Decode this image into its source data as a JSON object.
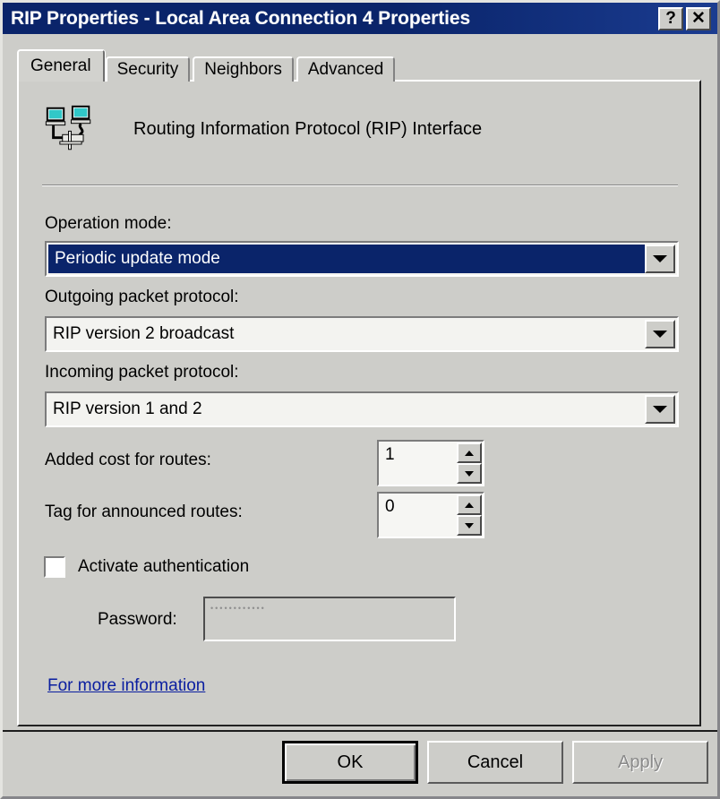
{
  "window": {
    "title": "RIP Properties - Local Area Connection 4 Properties",
    "help_button": "?",
    "close_button": "✕",
    "help_icon_name": "help-icon",
    "close_icon_name": "close-icon"
  },
  "tabs": [
    {
      "label": "General",
      "active": true
    },
    {
      "label": "Security",
      "active": false
    },
    {
      "label": "Neighbors",
      "active": false
    },
    {
      "label": "Advanced",
      "active": false
    }
  ],
  "header": {
    "caption": "Routing Information Protocol (RIP) Interface",
    "icon": "network-computers-icon"
  },
  "form": {
    "operation_mode": {
      "label": "Operation mode:",
      "value": "Periodic update mode",
      "selected": true
    },
    "outgoing_protocol": {
      "label": "Outgoing packet protocol:",
      "value": "RIP version 2 broadcast"
    },
    "incoming_protocol": {
      "label": "Incoming packet protocol:",
      "value": "RIP version 1 and 2"
    },
    "added_cost": {
      "label": "Added cost for routes:",
      "value": "1"
    },
    "route_tag": {
      "label": "Tag for announced routes:",
      "value": "0"
    },
    "activate_auth": {
      "label": "Activate authentication",
      "checked": false
    },
    "password": {
      "label": "Password:",
      "value": "••••••••••••",
      "disabled": true
    }
  },
  "link": {
    "more_information": "For more information"
  },
  "footer": {
    "ok": "OK",
    "cancel": "Cancel",
    "apply": "Apply"
  },
  "colors": {
    "titlebar": "#0a246a",
    "face": "#cdcdc9",
    "selection": "#0a246a",
    "link": "#0a1ea0",
    "disabled_text": "#8a8a8a"
  }
}
